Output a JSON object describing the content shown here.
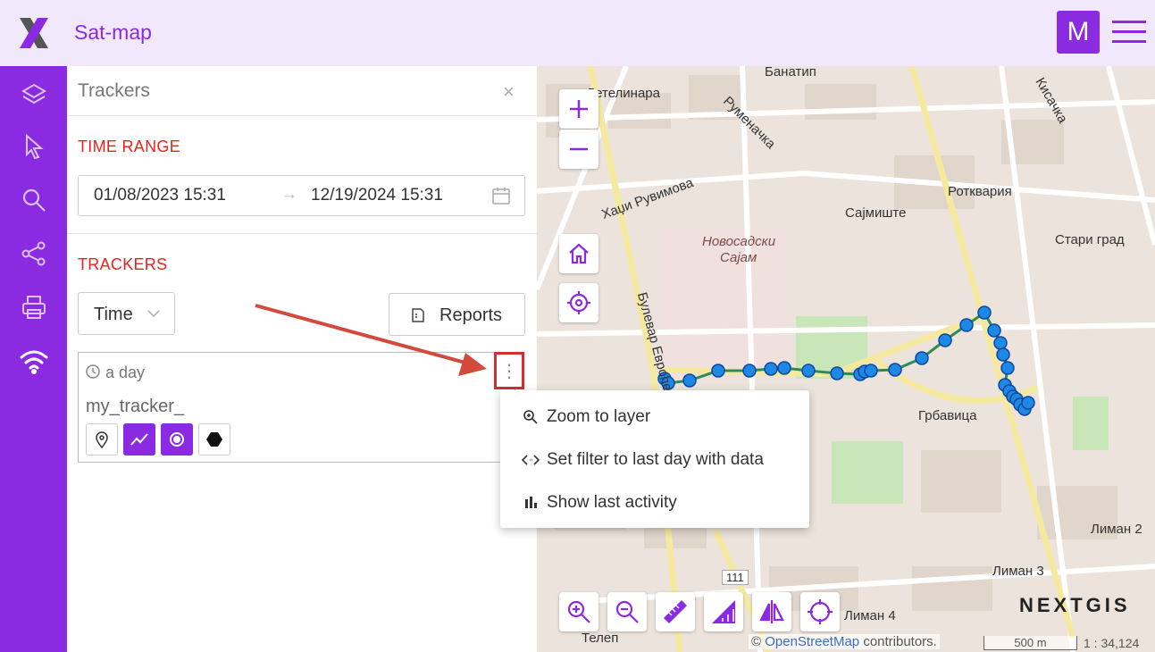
{
  "header": {
    "app_title": "Sat-map",
    "avatar_letter": "M",
    "brand_color": "#8a2be2"
  },
  "rail": {
    "items": [
      {
        "icon": "layers-icon"
      },
      {
        "icon": "cursor-icon"
      },
      {
        "icon": "search-icon"
      },
      {
        "icon": "share-icon"
      },
      {
        "icon": "print-icon"
      },
      {
        "icon": "wifi-icon"
      }
    ]
  },
  "panel": {
    "title": "Trackers",
    "close": "×",
    "time_range_title": "TIME RANGE",
    "range_start": "01/08/2023 15:31",
    "range_arrow": "→",
    "range_end": "12/19/2024 15:31",
    "trackers_title": "TRACKERS",
    "time_select": "Time",
    "reports_label": "Reports",
    "tracker": {
      "period": "a day",
      "name": "my_tracker_",
      "kebab": "⋮"
    }
  },
  "context_menu": {
    "items": [
      {
        "label": "Zoom to layer",
        "icon": "zoom-layer-icon"
      },
      {
        "label": "Set filter to last day with data",
        "icon": "code-icon"
      },
      {
        "label": "Show last activity",
        "icon": "bar-chart-icon"
      }
    ]
  },
  "map": {
    "labels": {
      "banatip": "Банатип",
      "detelinara": "Детелинара",
      "rumenachka": "Руменачка",
      "kisachka": "Кисачка",
      "hadzi": "Хаџи Рувимова",
      "rotkvarija": "Ротквария",
      "sajmiste": "Сајмиште",
      "novosadski_line1": "Новосадски",
      "novosadski_line2": "Сајам",
      "stari_grad": "Стари град",
      "bulevar": "Булевар Европе",
      "grbavica": "Грбавица",
      "liman2": "Лиман 2",
      "liman3": "Лиман 3",
      "liman4": "Лиман 4",
      "telep": "Телеп",
      "road_111": "111"
    },
    "attribution_prefix": "©",
    "attribution_link": "OpenStreetMap",
    "attribution_suffix": "contributors.",
    "scale_label": "500 m",
    "scale_ratio": "1 : 34,124",
    "brand": "NEXTGIS"
  }
}
